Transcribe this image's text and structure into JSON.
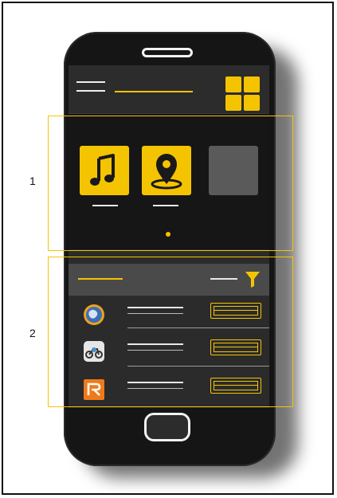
{
  "annotations": {
    "section1_number": "1",
    "section2_number": "2"
  },
  "colors": {
    "accent": "#f5c400",
    "screen_bg": "#2b2b2b",
    "phone_body": "#151515",
    "list_header": "#4a4a4a",
    "empty_tile": "#5a5a5a"
  },
  "header": {
    "menu_icon": "hamburger-menu-icon",
    "app_grid_icon": "grid-icon"
  },
  "carousel": {
    "tiles": [
      {
        "icon": "music-note-icon"
      },
      {
        "icon": "map-pin-icon"
      },
      {
        "icon": "empty-tile"
      }
    ],
    "page_indicator": "page-dot"
  },
  "list": {
    "filter_icon": "filter-funnel-icon",
    "rows": [
      {
        "icon": "globe-app-icon"
      },
      {
        "icon": "motorbike-app-icon"
      },
      {
        "icon": "r-letter-app-icon"
      }
    ]
  }
}
